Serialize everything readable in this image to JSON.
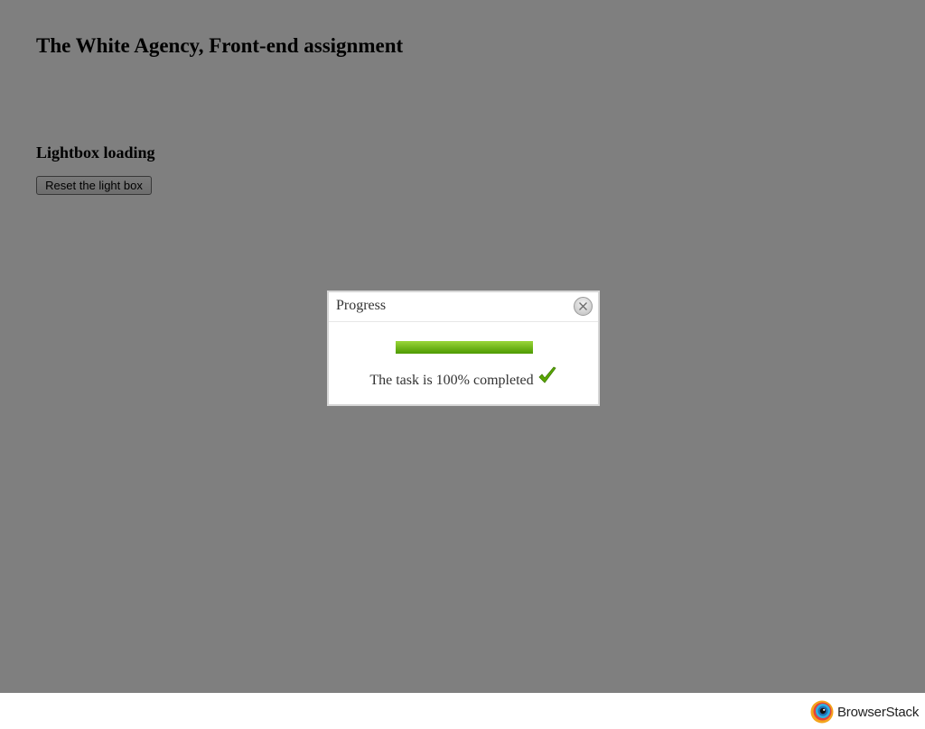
{
  "page": {
    "title": "The White Agency, Front-end assignment",
    "section_heading": "Lightbox loading",
    "reset_button_label": "Reset the light box"
  },
  "lightbox": {
    "title": "Progress",
    "progress_fraction": 1.0,
    "status_text": "The task is 100% completed",
    "close_icon": "close-icon",
    "status_icon": "checkmark-icon"
  },
  "footer": {
    "brand": "BrowserStack",
    "logo_icon": "browserstack-logo-icon"
  },
  "colors": {
    "overlay": "#808080",
    "progress_green": "#4d9a00",
    "check_green": "#5aa800"
  }
}
